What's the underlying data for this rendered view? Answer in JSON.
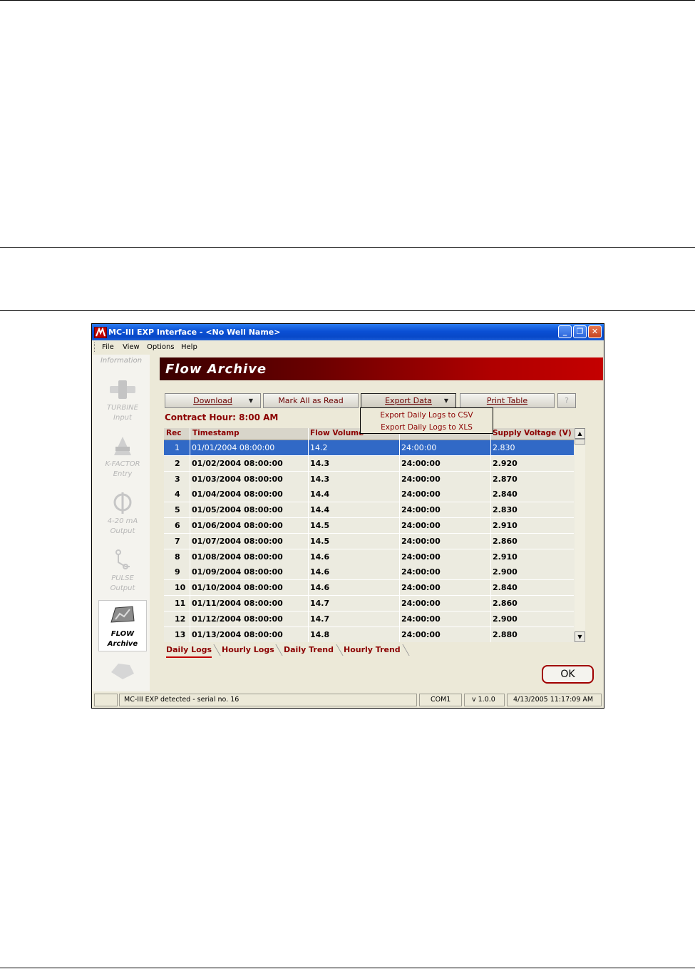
{
  "window": {
    "title": "MC-III EXP Interface - <No Well Name>",
    "minimize": "_",
    "restore": "❐",
    "close": "✕"
  },
  "menu": [
    "File",
    "View",
    "Options",
    "Help"
  ],
  "sidebar": {
    "header": "Information",
    "items": [
      {
        "line1": "TURBINE",
        "line2": "Input"
      },
      {
        "line1": "K-FACTOR",
        "line2": "Entry"
      },
      {
        "line1": "4-20 mA",
        "line2": "Output"
      },
      {
        "line1": "PULSE",
        "line2": "Output"
      },
      {
        "line1": "FLOW",
        "line2": "Archive"
      }
    ]
  },
  "banner": {
    "title": "Flow Archive"
  },
  "toolbar": {
    "download": "Download",
    "mark_all": "Mark All as Read",
    "export": "Export Data",
    "print": "Print Table",
    "help": "?"
  },
  "export_menu": [
    "Export Daily Logs to CSV",
    "Export Daily Logs to XLS"
  ],
  "contract_hour": "Contract Hour: 8:00 AM",
  "table": {
    "columns": [
      "Rec",
      "Timestamp",
      "Flow Volume",
      "Supply Voltage (V)"
    ],
    "rows": [
      [
        "1",
        "01/01/2004 08:00:00",
        "14.2",
        "24:00:00",
        "2.830"
      ],
      [
        "2",
        "01/02/2004 08:00:00",
        "14.3",
        "24:00:00",
        "2.920"
      ],
      [
        "3",
        "01/03/2004 08:00:00",
        "14.3",
        "24:00:00",
        "2.870"
      ],
      [
        "4",
        "01/04/2004 08:00:00",
        "14.4",
        "24:00:00",
        "2.840"
      ],
      [
        "5",
        "01/05/2004 08:00:00",
        "14.4",
        "24:00:00",
        "2.830"
      ],
      [
        "6",
        "01/06/2004 08:00:00",
        "14.5",
        "24:00:00",
        "2.910"
      ],
      [
        "7",
        "01/07/2004 08:00:00",
        "14.5",
        "24:00:00",
        "2.860"
      ],
      [
        "8",
        "01/08/2004 08:00:00",
        "14.6",
        "24:00:00",
        "2.910"
      ],
      [
        "9",
        "01/09/2004 08:00:00",
        "14.6",
        "24:00:00",
        "2.900"
      ],
      [
        "10",
        "01/10/2004 08:00:00",
        "14.6",
        "24:00:00",
        "2.840"
      ],
      [
        "11",
        "01/11/2004 08:00:00",
        "14.7",
        "24:00:00",
        "2.860"
      ],
      [
        "12",
        "01/12/2004 08:00:00",
        "14.7",
        "24:00:00",
        "2.900"
      ],
      [
        "13",
        "01/13/2004 08:00:00",
        "14.8",
        "24:00:00",
        "2.880"
      ]
    ],
    "selected_row": 0
  },
  "tabs": [
    "Daily Logs",
    "Hourly Logs",
    "Daily Trend",
    "Hourly Trend"
  ],
  "ok": "OK",
  "status": {
    "message": "MC-III EXP detected - serial no. 16",
    "port": "COM1",
    "version": "v 1.0.0",
    "datetime": "4/13/2005 11:17:09 AM"
  },
  "colors": {
    "accent": "#8b0000",
    "selection": "#3169c6",
    "titlebar": "#0a4fd4"
  }
}
